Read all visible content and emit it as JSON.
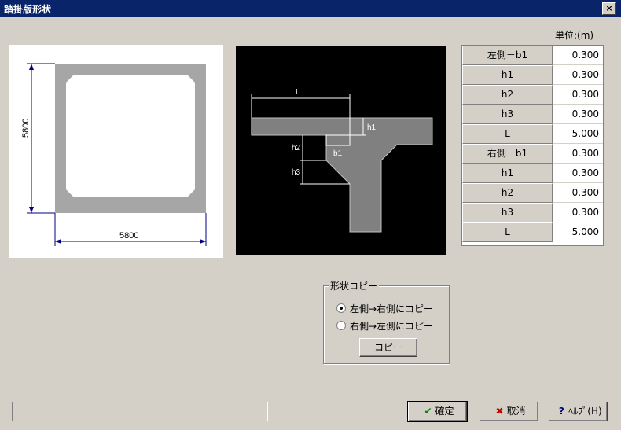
{
  "window": {
    "title": "踏掛版形状",
    "close_glyph": "×"
  },
  "unit_label": "単位:(m)",
  "left_drawing": {
    "width_dim": "5800",
    "height_dim": "5800"
  },
  "right_drawing": {
    "labels": {
      "L": "L",
      "h1": "h1",
      "h2": "h2",
      "h3": "h3",
      "b1": "b1"
    }
  },
  "table": {
    "rows": [
      {
        "label": "左側－b1",
        "value": "0.300"
      },
      {
        "label": "h1",
        "value": "0.300"
      },
      {
        "label": "h2",
        "value": "0.300"
      },
      {
        "label": "h3",
        "value": "0.300"
      },
      {
        "label": "L",
        "value": "5.000"
      },
      {
        "label": "右側－b1",
        "value": "0.300"
      },
      {
        "label": "h1",
        "value": "0.300"
      },
      {
        "label": "h2",
        "value": "0.300"
      },
      {
        "label": "h3",
        "value": "0.300"
      },
      {
        "label": "L",
        "value": "5.000"
      }
    ]
  },
  "copy_group": {
    "title": "形状コピー",
    "option_left_to_right": "左側→右側にコピー",
    "option_right_to_left": "右側→左側にコピー",
    "selected": "left_to_right",
    "copy_button": "コピー"
  },
  "buttons": {
    "ok": "確定",
    "cancel": "取消",
    "help": "ﾍﾙﾌﾟ(H)"
  },
  "colors": {
    "titlebar": "#0a246a",
    "section": "#a6a6a6",
    "dim_line": "#000080"
  }
}
